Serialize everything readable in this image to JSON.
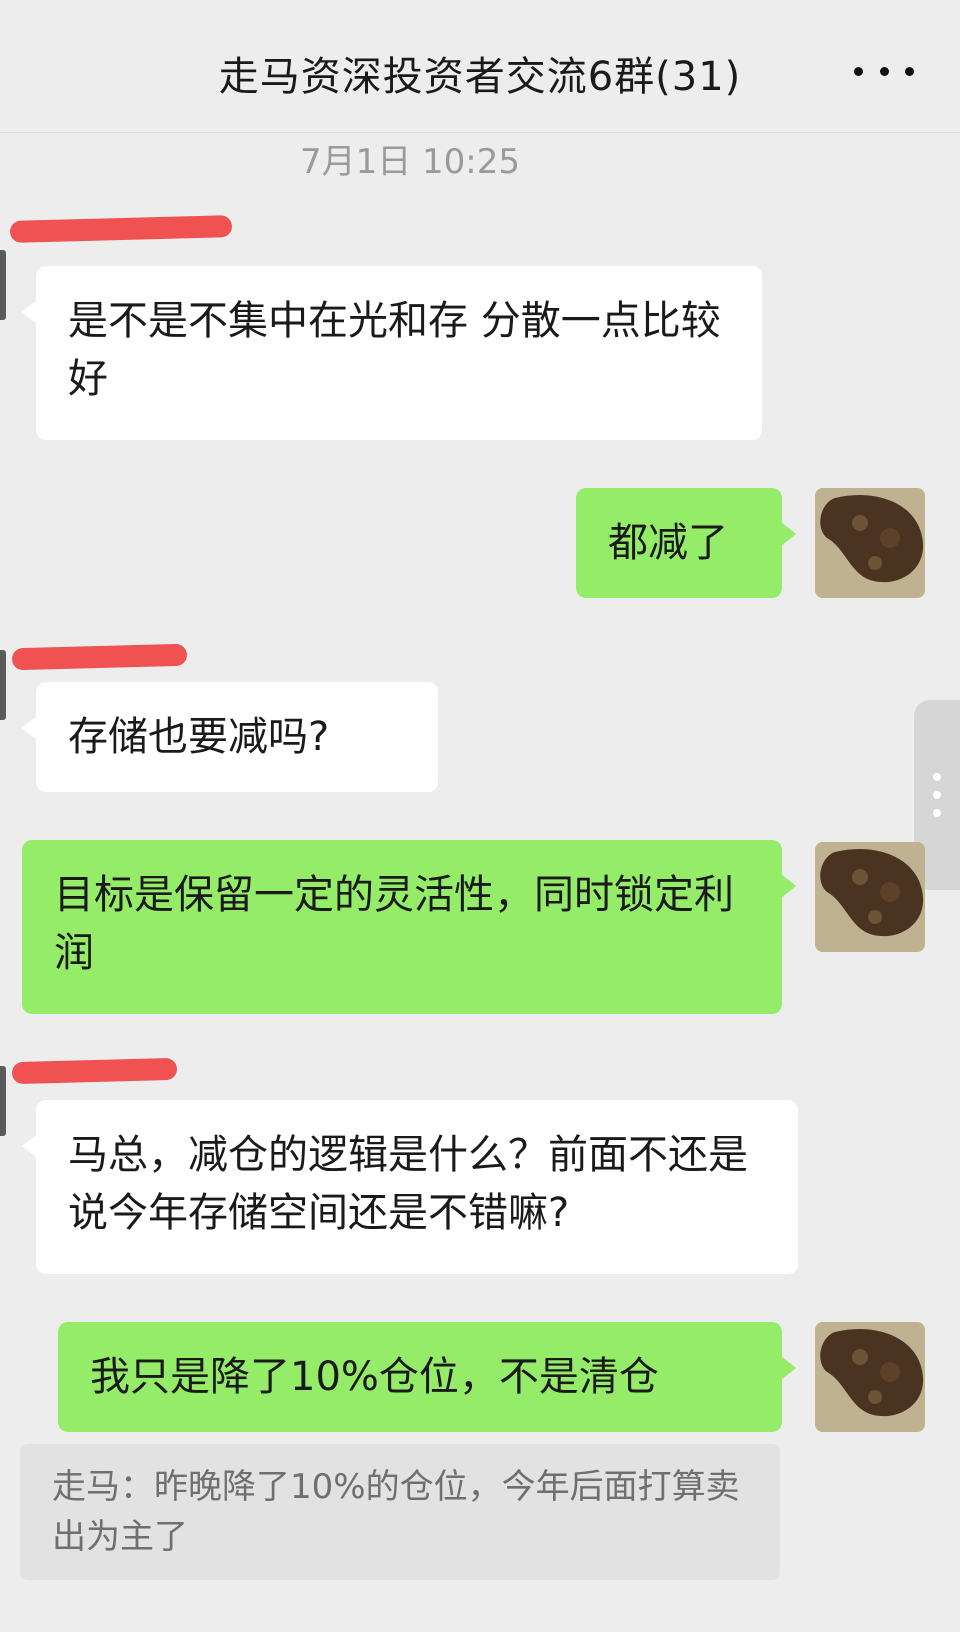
{
  "header": {
    "title": "走马资深投资者交流6群(31)",
    "more_icon": "more-icon"
  },
  "timestamp": "7月1日 10:25",
  "messages": [
    {
      "side": "left",
      "text": "是不是不集中在光和存 分散一点比较好"
    },
    {
      "side": "right",
      "text": "都减了"
    },
    {
      "side": "left",
      "text": "存储也要减吗?"
    },
    {
      "side": "right",
      "text": "目标是保留一定的灵活性，同时锁定利润"
    },
    {
      "side": "left",
      "text": "马总，减仓的逻辑是什么？前面不还是说今年存储空间还是不错嘛?"
    },
    {
      "side": "right",
      "text": "我只是降了10%仓位，不是清仓"
    }
  ],
  "quote": {
    "text": "走马：昨晚降了10%的仓位，今年后面打算卖出为主了"
  },
  "colors": {
    "background": "#ededed",
    "green_bubble": "#95ec69",
    "white_bubble": "#ffffff",
    "redaction": "#f05252"
  }
}
